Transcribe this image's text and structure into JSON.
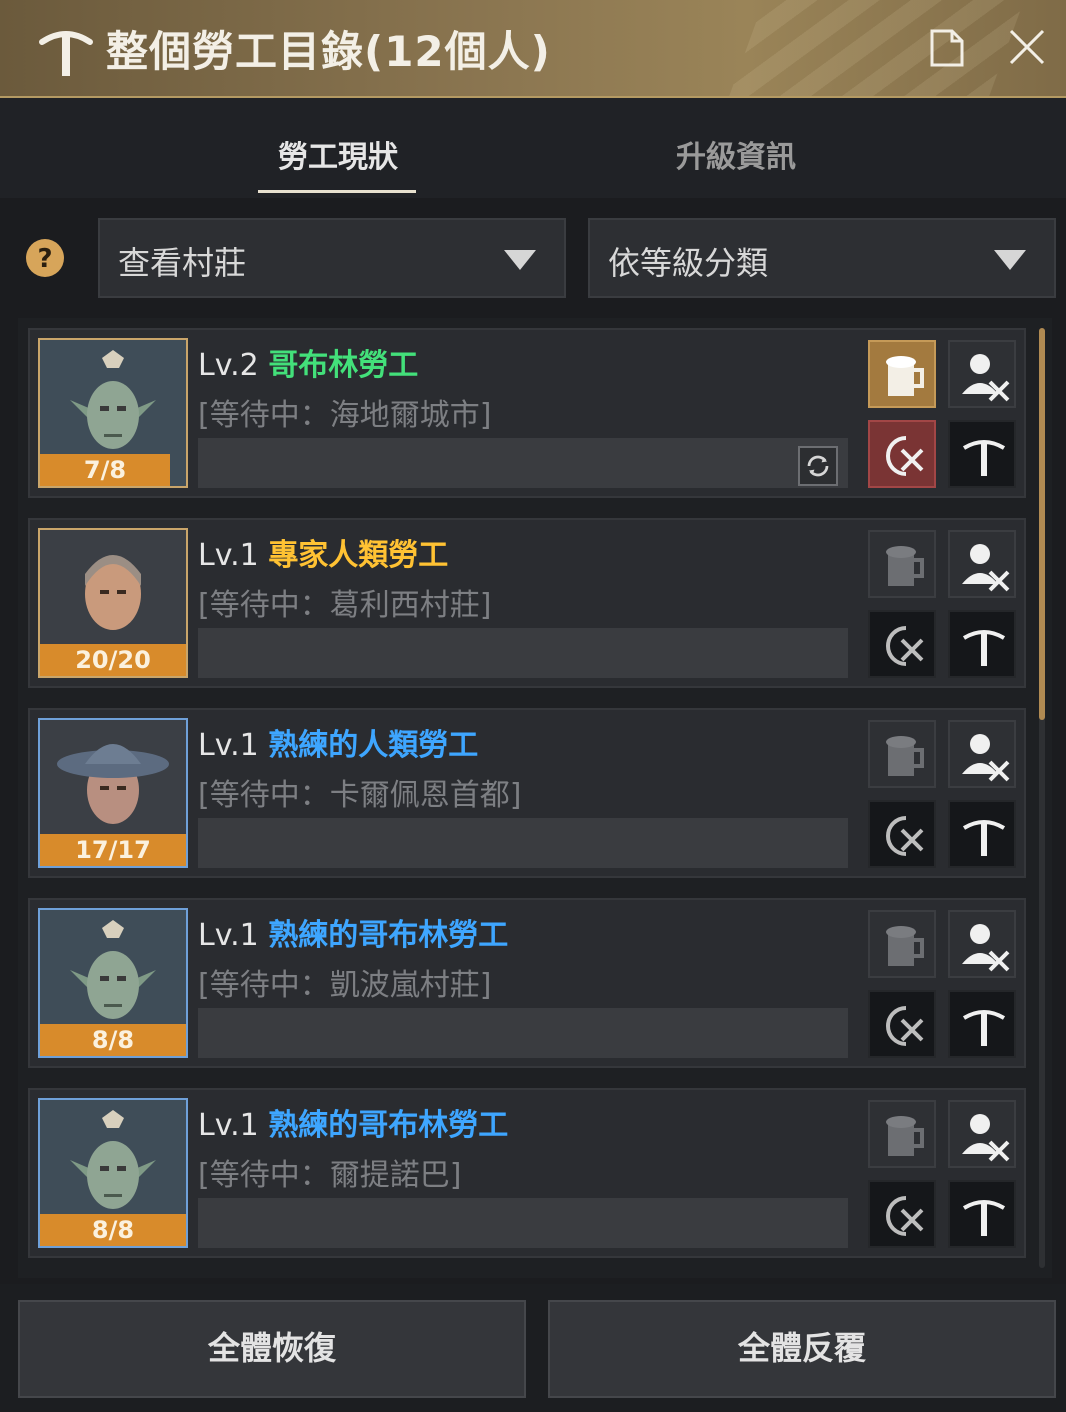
{
  "window": {
    "title": "整個勞工目錄(12個人)"
  },
  "tabs": [
    {
      "label": "勞工現狀",
      "active": true
    },
    {
      "label": "升級資訊",
      "active": false
    }
  ],
  "filters": {
    "village": "查看村莊",
    "sort": "依等級分類"
  },
  "workers": [
    {
      "level": "Lv.2",
      "name": "哥布林勞工",
      "name_color": "#43e07a",
      "status": "[等待中：海地爾城市]",
      "stamina": "7/8",
      "stamina_fraction": 0.875
    },
    {
      "level": "Lv.1",
      "name": "專家人類勞工",
      "name_color": "#ffc233",
      "status": "[等待中：葛利西村莊]",
      "stamina": "20/20",
      "stamina_fraction": 1.0
    },
    {
      "level": "Lv.1",
      "name": "熟練的人類勞工",
      "name_color": "#3ea6ff",
      "status": "[等待中：卡爾佩恩首都]",
      "stamina": "17/17",
      "stamina_fraction": 1.0
    },
    {
      "level": "Lv.1",
      "name": "熟練的哥布林勞工",
      "name_color": "#3ea6ff",
      "status": "[等待中：凱波嵐村莊]",
      "stamina": "8/8",
      "stamina_fraction": 1.0
    },
    {
      "level": "Lv.1",
      "name": "熟練的哥布林勞工",
      "name_color": "#3ea6ff",
      "status": "[等待中：爾提諾巴]",
      "stamina": "8/8",
      "stamina_fraction": 1.0
    }
  ],
  "icons": {
    "title": "pickaxe-icon",
    "doc": "document-icon",
    "close": "close-icon",
    "help": "help-icon",
    "restore": "beer-mug-icon",
    "fire": "fire-worker-icon",
    "cancel": "cancel-repeat-icon",
    "work": "pickaxe-icon",
    "refresh": "refresh-icon"
  },
  "bottom": {
    "restore_all": "全體恢復",
    "repeat_all": "全體反覆"
  },
  "colors": {
    "accent": "#b49a63",
    "stamina": "#d88b2b"
  }
}
